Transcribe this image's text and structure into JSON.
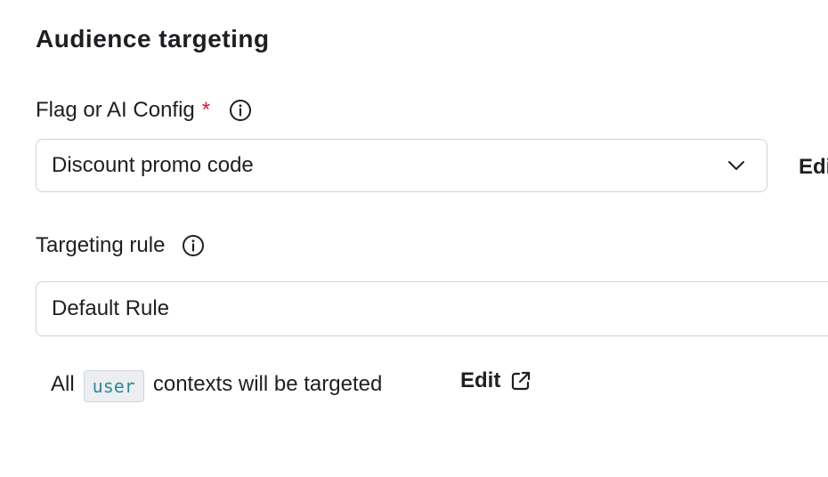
{
  "section": {
    "title": "Audience targeting"
  },
  "flag_field": {
    "label": "Flag or AI Config",
    "required_marker": "*",
    "info_icon": "info-circle-icon",
    "selected_value": "Discount promo code",
    "chevron_icon": "chevron-down-icon",
    "side_action_label": "Edit"
  },
  "rule_field": {
    "label": "Targeting rule",
    "info_icon": "info-circle-icon",
    "value": "Default Rule"
  },
  "context_summary": {
    "prefix": "All",
    "context_kind": "user",
    "suffix": "contexts will be targeted",
    "edit_label": "Edit",
    "edit_icon": "external-link-icon"
  },
  "colors": {
    "text": "#1f1f23",
    "required": "#d4183b",
    "border": "#cfd1d6",
    "code_text": "#2a8a9a",
    "code_bg": "#eceef1"
  }
}
